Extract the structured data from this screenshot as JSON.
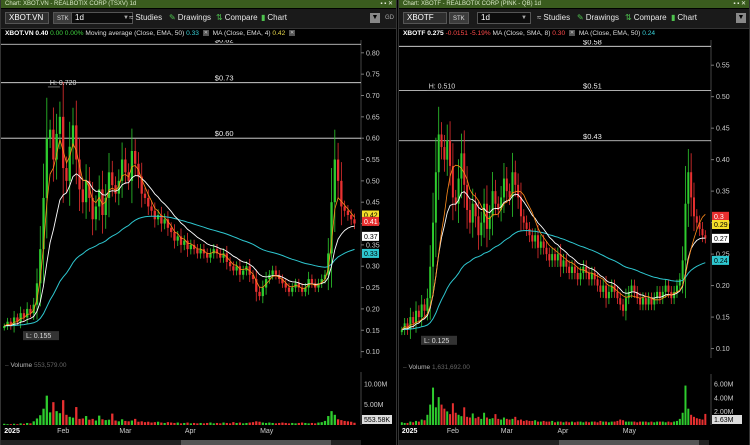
{
  "colors": {
    "up": "#2ecc2e",
    "down": "#e83030",
    "ema_fast": "#ff8c1a",
    "ema_mid": "#ffffff",
    "ema_slow": "#2ec7d0",
    "level": "#e8e8e8",
    "title_bg": "#3a5c1e"
  },
  "icons": {
    "studies": "studies-icon",
    "drawings": "drawings-icon",
    "compare": "compare-icon",
    "chart": "chart-icon",
    "menu": "menu-caret-icon",
    "close": "close-icon"
  },
  "left": {
    "window_title": "Chart: XBOT.VN - REALBOTIX CORP (TSXV) 1d",
    "symbol": "XBOT.VN",
    "stk": "STK",
    "interval": "1d",
    "toolbar": {
      "studies": "Studies",
      "drawings": "Drawings",
      "compare": "Compare",
      "chart": "Chart",
      "gd": "GD"
    },
    "legend": {
      "symbol": "XBOT.VN",
      "last": "0.40",
      "change": "0.00",
      "pct": "0.00%",
      "ma1_label": "Moving average (Close, EMA, 50)",
      "ma1_value": "0.33",
      "ma2_label": "MA (Close, EMA, 4)",
      "ma2_value": "0.42"
    },
    "volume_header": {
      "label": "Volume",
      "value": "553,579.00"
    },
    "x_axis": [
      "2025",
      "Feb",
      "Mar",
      "Apr",
      "May"
    ],
    "chart_data": {
      "type": "candlestick",
      "y_ticks": [
        "0.80",
        "0.75",
        "0.70",
        "0.65",
        "0.60",
        "0.55",
        "0.50",
        "0.45",
        "0.40",
        "0.35",
        "0.30",
        "0.25",
        "0.20",
        "0.15",
        "0.10"
      ],
      "ylim": [
        0.085,
        0.83
      ],
      "levels": [
        {
          "value": 0.82,
          "label": "$0.82"
        },
        {
          "value": 0.73,
          "label": "$0.73"
        },
        {
          "value": 0.6,
          "label": "$0.60"
        }
      ],
      "high_label": {
        "text": "H: 0.720",
        "value": 0.72
      },
      "low_label": {
        "text": "L: 0.155",
        "value": 0.155
      },
      "price_badges": [
        {
          "value": 0.42,
          "text": "0.42",
          "bg": "#f5e02a",
          "fg": "#000"
        },
        {
          "value": 0.405,
          "text": "0.41",
          "bg": "#e83030",
          "fg": "#fff"
        },
        {
          "value": 0.37,
          "text": "0.37",
          "bg": "#ffffff",
          "fg": "#000"
        },
        {
          "value": 0.33,
          "text": "0.33",
          "bg": "#2ec7d0",
          "fg": "#000"
        }
      ],
      "volume_ticks": [
        "10.00M",
        "5.00M"
      ],
      "volume_max": 13000000,
      "volume_badge": "553.58K",
      "closes": [
        0.16,
        0.17,
        0.16,
        0.18,
        0.17,
        0.19,
        0.18,
        0.2,
        0.19,
        0.21,
        0.26,
        0.34,
        0.46,
        0.6,
        0.62,
        0.55,
        0.61,
        0.65,
        0.53,
        0.5,
        0.58,
        0.63,
        0.55,
        0.48,
        0.45,
        0.5,
        0.46,
        0.41,
        0.44,
        0.48,
        0.42,
        0.46,
        0.52,
        0.49,
        0.47,
        0.5,
        0.55,
        0.52,
        0.5,
        0.57,
        0.54,
        0.51,
        0.47,
        0.46,
        0.44,
        0.43,
        0.41,
        0.42,
        0.4,
        0.41,
        0.39,
        0.38,
        0.36,
        0.37,
        0.35,
        0.36,
        0.34,
        0.35,
        0.34,
        0.33,
        0.34,
        0.33,
        0.32,
        0.33,
        0.34,
        0.33,
        0.32,
        0.33,
        0.31,
        0.3,
        0.29,
        0.3,
        0.28,
        0.29,
        0.3,
        0.28,
        0.27,
        0.24,
        0.23,
        0.25,
        0.27,
        0.28,
        0.29,
        0.28,
        0.27,
        0.26,
        0.25,
        0.24,
        0.25,
        0.26,
        0.25,
        0.24,
        0.25,
        0.27,
        0.26,
        0.25,
        0.26,
        0.27,
        0.28,
        0.33,
        0.45,
        0.55,
        0.5,
        0.44,
        0.43,
        0.42,
        0.41,
        0.4
      ],
      "volumes": [
        0.3,
        0.2,
        0.2,
        0.3,
        0.2,
        0.4,
        0.3,
        0.5,
        0.4,
        0.9,
        1.6,
        2.4,
        4.0,
        7.2,
        3.1,
        5.6,
        3.4,
        2.9,
        6.1,
        2.5,
        2.0,
        1.8,
        4.4,
        1.5,
        1.6,
        2.2,
        1.3,
        1.5,
        1.1,
        2.3,
        1.4,
        1.2,
        1.3,
        2.8,
        1.1,
        0.9,
        1.4,
        1.0,
        0.9,
        1.1,
        1.5,
        0.8,
        0.9,
        0.7,
        0.8,
        0.6,
        0.7,
        0.8,
        0.6,
        0.5,
        0.7,
        0.6,
        0.5,
        0.6,
        0.4,
        0.5,
        0.6,
        0.4,
        0.5,
        0.4,
        0.5,
        0.4,
        0.5,
        0.6,
        0.4,
        0.5,
        0.4,
        0.6,
        0.5,
        0.4,
        0.7,
        0.5,
        0.6,
        0.4,
        0.5,
        0.6,
        0.7,
        0.9,
        0.8,
        0.6,
        0.5,
        0.6,
        0.5,
        0.4,
        0.5,
        0.6,
        0.5,
        0.4,
        0.5,
        0.4,
        0.5,
        0.6,
        0.5,
        0.4,
        0.5,
        0.4,
        0.6,
        0.7,
        1.0,
        2.2,
        3.4,
        2.5,
        1.4,
        1.2,
        1.0,
        0.9,
        0.8,
        0.55
      ]
    }
  },
  "right": {
    "window_title": "Chart: XBOTF - REALBOTIX CORP (PINK - QB) 1d",
    "symbol": "XBOTF",
    "stk": "STK",
    "interval": "1d",
    "toolbar": {
      "studies": "Studies",
      "drawings": "Drawings",
      "compare": "Compare",
      "chart": "Chart"
    },
    "legend": {
      "symbol": "XBOTF",
      "last": "0.275",
      "change": "-0.0151",
      "pct": "-5.19%",
      "ma1_label": "MA (Close, SMA, 8)",
      "ma1_value": "0.30",
      "ma2_label": "MA (Close, EMA, 50)",
      "ma2_value": "0.24"
    },
    "volume_header": {
      "label": "Volume",
      "value": "1,631,692.00"
    },
    "x_axis": [
      "2025",
      "Feb",
      "Mar",
      "Apr",
      "May"
    ],
    "chart_data": {
      "type": "candlestick",
      "y_ticks": [
        "0.55",
        "0.50",
        "0.45",
        "0.40",
        "0.35",
        "0.30",
        "0.25",
        "0.20",
        "0.15",
        "0.10"
      ],
      "ylim": [
        0.085,
        0.59
      ],
      "levels": [
        {
          "value": 0.58,
          "label": "$0.58"
        },
        {
          "value": 0.51,
          "label": "$0.51"
        },
        {
          "value": 0.43,
          "label": "$0.43"
        }
      ],
      "high_label": {
        "text": "H: 0.510",
        "value": 0.51
      },
      "low_label": {
        "text": "L: 0.125",
        "value": 0.125
      },
      "price_badges": [
        {
          "value": 0.31,
          "text": "0.3",
          "bg": "#e83030",
          "fg": "#fff"
        },
        {
          "value": 0.297,
          "text": "0.29",
          "bg": "#f5e02a",
          "fg": "#000"
        },
        {
          "value": 0.275,
          "text": "0.27",
          "bg": "#ffffff",
          "fg": "#000"
        },
        {
          "value": 0.24,
          "text": "0.24",
          "bg": "#2ec7d0",
          "fg": "#000"
        }
      ],
      "volume_ticks": [
        "6.00M",
        "4.00M",
        "2.00M"
      ],
      "volume_max": 7500000,
      "volume_badge": "1.63M",
      "closes": [
        0.13,
        0.14,
        0.13,
        0.15,
        0.14,
        0.16,
        0.15,
        0.17,
        0.16,
        0.18,
        0.23,
        0.3,
        0.38,
        0.44,
        0.42,
        0.4,
        0.43,
        0.39,
        0.34,
        0.33,
        0.37,
        0.41,
        0.36,
        0.32,
        0.3,
        0.33,
        0.31,
        0.28,
        0.3,
        0.33,
        0.29,
        0.31,
        0.35,
        0.33,
        0.32,
        0.34,
        0.37,
        0.35,
        0.34,
        0.38,
        0.36,
        0.34,
        0.31,
        0.3,
        0.29,
        0.28,
        0.27,
        0.28,
        0.26,
        0.27,
        0.26,
        0.25,
        0.24,
        0.25,
        0.24,
        0.25,
        0.23,
        0.24,
        0.23,
        0.22,
        0.23,
        0.22,
        0.21,
        0.22,
        0.23,
        0.22,
        0.21,
        0.22,
        0.21,
        0.2,
        0.19,
        0.2,
        0.18,
        0.19,
        0.2,
        0.19,
        0.18,
        0.17,
        0.16,
        0.18,
        0.19,
        0.2,
        0.19,
        0.18,
        0.17,
        0.18,
        0.17,
        0.18,
        0.17,
        0.18,
        0.19,
        0.18,
        0.19,
        0.2,
        0.19,
        0.18,
        0.19,
        0.2,
        0.21,
        0.24,
        0.33,
        0.38,
        0.34,
        0.31,
        0.3,
        0.29,
        0.28,
        0.275
      ],
      "volumes": [
        0.4,
        0.3,
        0.3,
        0.5,
        0.4,
        0.6,
        0.5,
        0.8,
        0.7,
        1.5,
        3.0,
        5.5,
        2.6,
        4.1,
        3.0,
        2.4,
        2.0,
        1.6,
        3.2,
        1.8,
        1.5,
        1.3,
        2.6,
        1.2,
        1.1,
        1.7,
        1.0,
        1.2,
        0.9,
        1.8,
        1.1,
        0.9,
        1.0,
        1.6,
        0.9,
        0.8,
        1.1,
        0.9,
        0.8,
        0.9,
        1.2,
        0.7,
        0.8,
        0.6,
        0.7,
        0.6,
        0.6,
        0.7,
        0.5,
        0.5,
        0.6,
        0.5,
        0.5,
        0.6,
        0.4,
        0.5,
        0.5,
        0.4,
        0.5,
        0.4,
        0.5,
        0.4,
        0.5,
        0.5,
        0.4,
        0.5,
        0.4,
        0.5,
        0.5,
        0.4,
        0.6,
        0.5,
        0.5,
        0.4,
        0.5,
        0.5,
        0.6,
        0.8,
        0.7,
        0.5,
        0.5,
        0.5,
        0.5,
        0.4,
        0.5,
        0.5,
        0.5,
        0.4,
        0.5,
        0.4,
        0.5,
        0.5,
        0.5,
        0.4,
        0.5,
        0.4,
        0.5,
        0.6,
        0.9,
        1.8,
        5.8,
        2.4,
        1.5,
        1.2,
        1.0,
        0.9,
        0.8,
        1.63
      ]
    }
  }
}
